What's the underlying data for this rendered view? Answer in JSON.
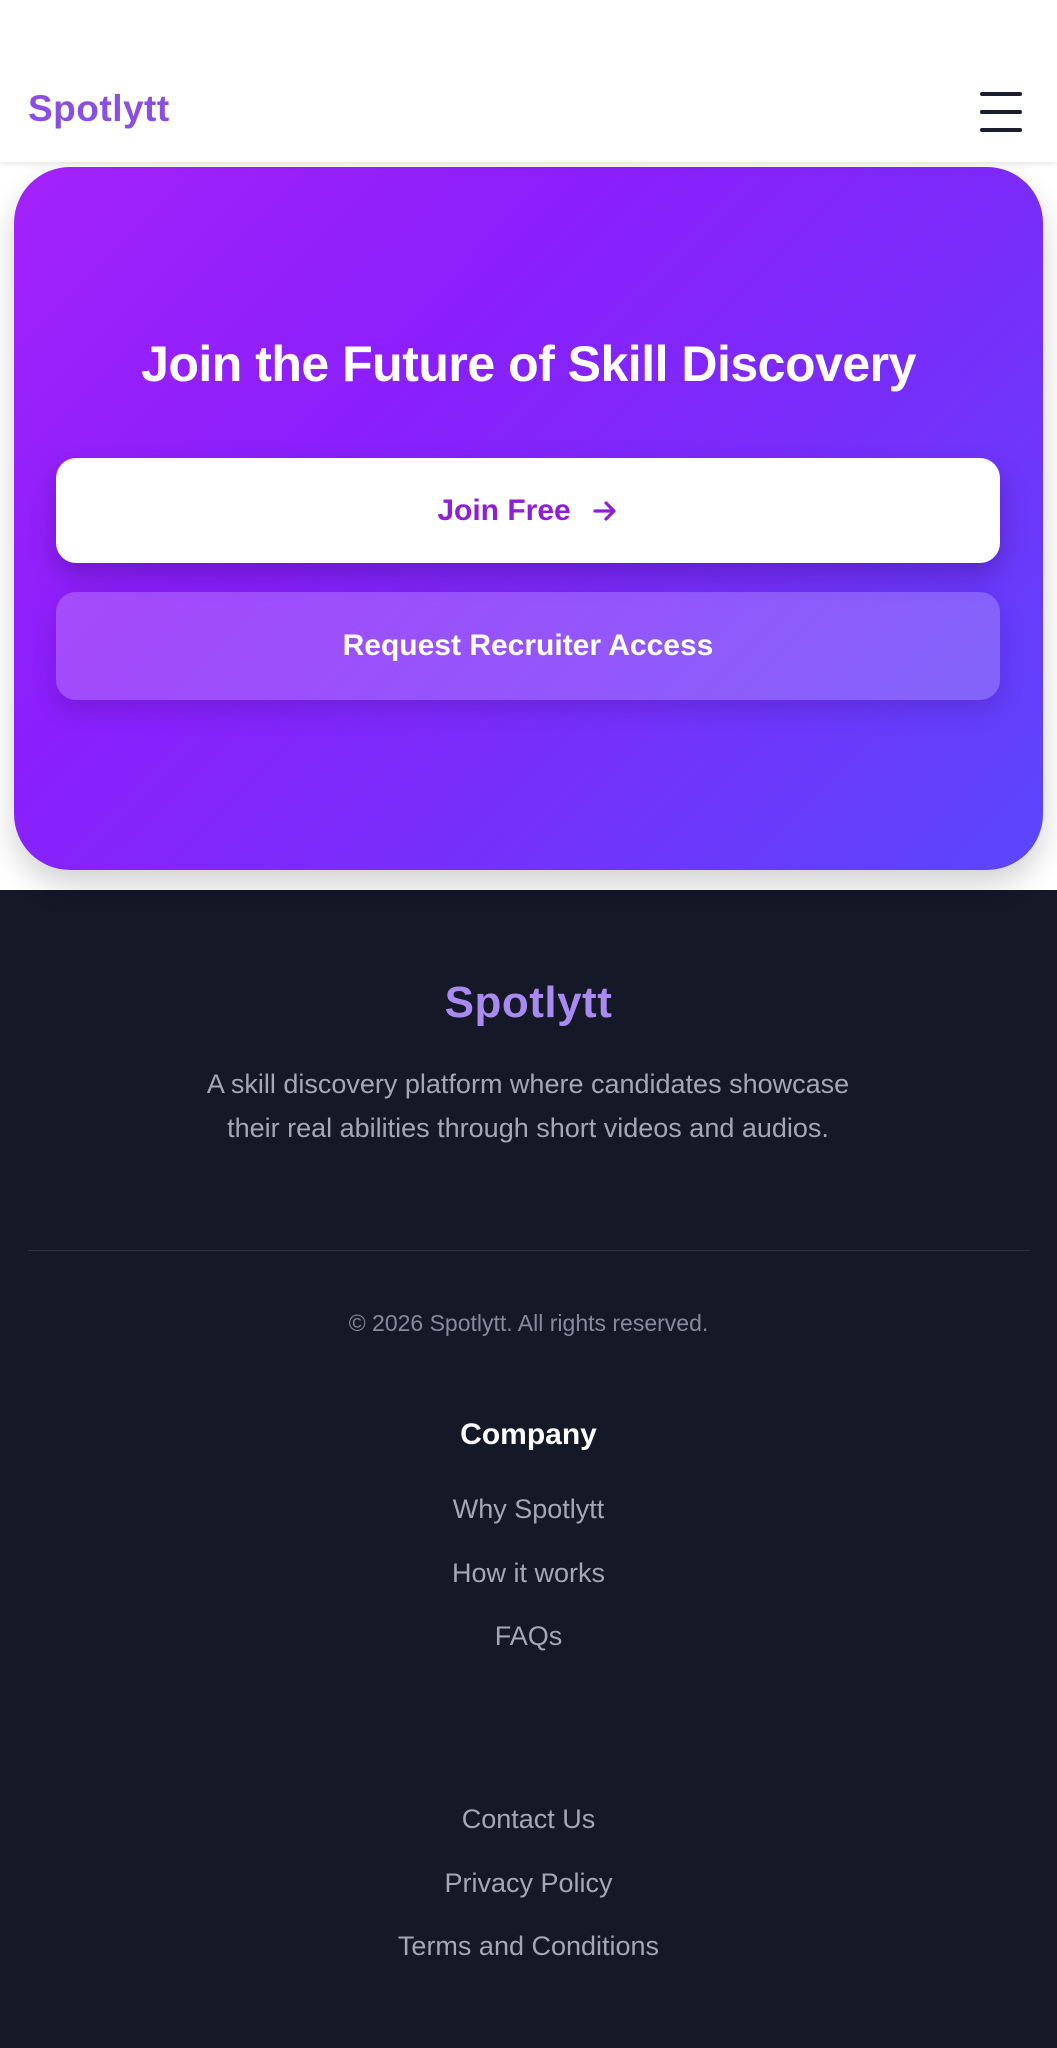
{
  "header": {
    "logo": "Spotlytt",
    "menu_icon": "hamburger-menu-icon"
  },
  "hero": {
    "title": "Join the Future of Skill Discovery",
    "join_label": "Join Free",
    "join_icon": "arrow-right-icon",
    "recruiter_label": "Request Recruiter Access"
  },
  "footer": {
    "logo": "Spotlytt",
    "description": "A skill discovery platform where candidates showcase their real abilities through short videos and audios.",
    "copyright": "© 2026 Spotlytt. All rights reserved.",
    "company_heading": "Company",
    "company_links": [
      "Why Spotlytt",
      "How it works",
      "FAQs"
    ],
    "legal_links": [
      "Contact Us",
      "Privacy Policy",
      "Terms and Conditions"
    ]
  },
  "colors": {
    "brand_purple": "#8a4fe0",
    "join_text": "#8f1fd6",
    "footer_bg": "#141827",
    "footer_logo": "#a98af0"
  }
}
